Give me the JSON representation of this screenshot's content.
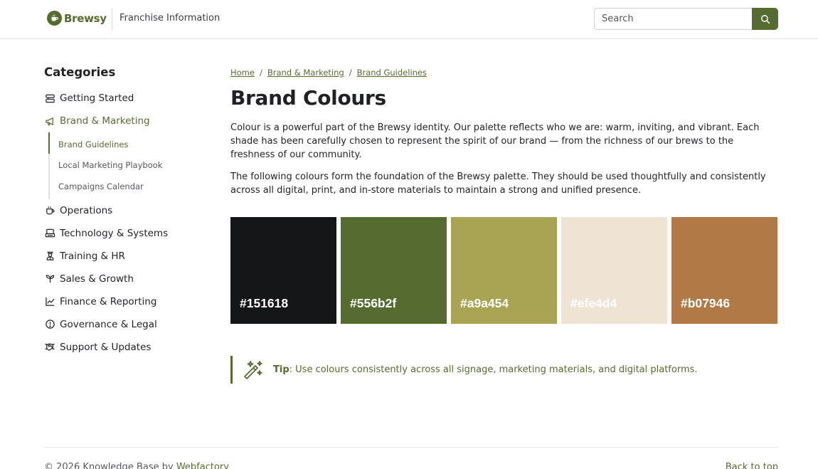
{
  "brand": {
    "name": "Brewsy",
    "color": "#556b2f"
  },
  "header": {
    "site_title": "Franchise Information",
    "search_placeholder": "Search"
  },
  "sidebar": {
    "heading": "Categories",
    "items": [
      {
        "label": "Getting Started",
        "icon": "book-stack-icon"
      },
      {
        "label": "Brand & Marketing",
        "icon": "megaphone-icon",
        "active": true,
        "children": [
          {
            "label": "Brand Guidelines",
            "active": true
          },
          {
            "label": "Local Marketing Playbook"
          },
          {
            "label": "Campaigns Calendar"
          }
        ]
      },
      {
        "label": "Operations",
        "icon": "cup-icon"
      },
      {
        "label": "Technology & Systems",
        "icon": "devices-icon"
      },
      {
        "label": "Training & HR",
        "icon": "person-icon"
      },
      {
        "label": "Sales & Growth",
        "icon": "sprout-icon"
      },
      {
        "label": "Finance & Reporting",
        "icon": "line-chart-icon"
      },
      {
        "label": "Governance & Legal",
        "icon": "info-circle-icon"
      },
      {
        "label": "Support & Updates",
        "icon": "handshake-icon"
      }
    ]
  },
  "breadcrumb": [
    "Home",
    "Brand & Marketing",
    "Brand Guidelines"
  ],
  "page": {
    "title": "Brand Colours",
    "paragraphs": [
      "Colour is a powerful part of the Brewsy identity. Our palette reflects who we are: warm, inviting, and vibrant. Each shade has been carefully chosen to represent the spirit of our brand — from the richness of our brews to the freshness of our community.",
      "The following colours form the foundation of the Brewsy palette. They should be used thoughtfully and consistently across all digital, print, and in-store materials to maintain a strong and unified presence."
    ],
    "swatches": [
      {
        "hex": "#151618",
        "label_color": "#ffffff"
      },
      {
        "hex": "#556b2f",
        "label_color": "#ffffff"
      },
      {
        "hex": "#a9a454",
        "label_color": "#ffffff"
      },
      {
        "hex": "#efe4d4",
        "label_color": "#ffffff"
      },
      {
        "hex": "#b07946",
        "label_color": "#ffffff"
      }
    ],
    "tip": {
      "label": "Tip",
      "text": ": Use colours consistently across all signage, marketing materials, and digital platforms."
    }
  },
  "footer": {
    "copyright": "© 2026 Knowledge Base by ",
    "credit": "Webfactory",
    "back_to_top": "Back to top"
  }
}
